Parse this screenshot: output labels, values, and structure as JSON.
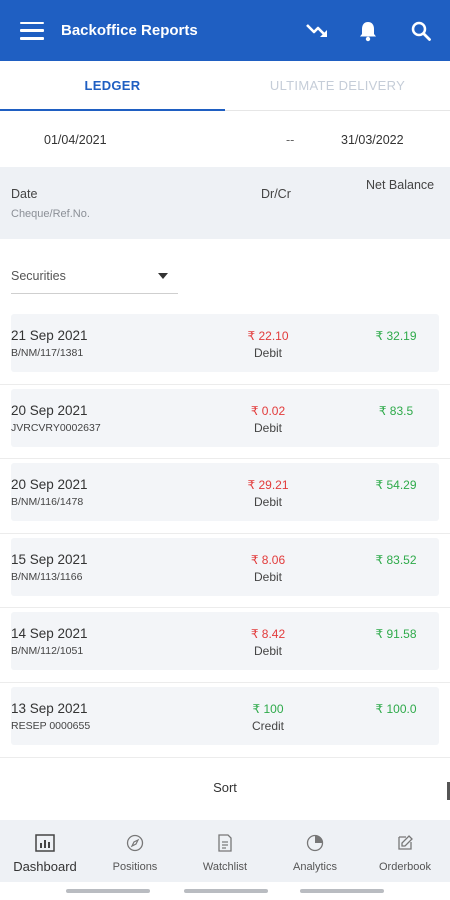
{
  "appbar": {
    "title": "Backoffice Reports",
    "icons": [
      "menu-icon",
      "trending-down-icon",
      "bell-icon",
      "search-icon"
    ],
    "color": "#1f5fc2"
  },
  "tabs": [
    {
      "label": "LEDGER",
      "active": true
    },
    {
      "label": "ULTIMATE DELIVERY",
      "active": false
    }
  ],
  "date_range": {
    "from": "01/04/2021",
    "separator": "--",
    "to": "31/03/2022"
  },
  "table_header": {
    "date": "Date",
    "cheque": "Cheque/Ref.No.",
    "drcr": "Dr/Cr",
    "net_balance": "Net Balance"
  },
  "filter": {
    "selected": "Securities"
  },
  "entries": [
    {
      "date": "21 Sep 2021",
      "ref": "B/NM/117/1381",
      "amount": "₹ 22.10",
      "type": "Debit",
      "balance": "₹ 32.19"
    },
    {
      "date": "20 Sep 2021",
      "ref": "JVRCVRY0002637",
      "amount": "₹ 0.02",
      "type": "Debit",
      "balance": "₹ 83.5"
    },
    {
      "date": "20 Sep 2021",
      "ref": "B/NM/116/1478",
      "amount": "₹ 29.21",
      "type": "Debit",
      "balance": "₹ 54.29"
    },
    {
      "date": "15 Sep 2021",
      "ref": "B/NM/113/1166",
      "amount": "₹ 8.06",
      "type": "Debit",
      "balance": "₹ 83.52"
    },
    {
      "date": "14 Sep 2021",
      "ref": "B/NM/112/1051",
      "amount": "₹ 8.42",
      "type": "Debit",
      "balance": "₹ 91.58"
    },
    {
      "date": "13 Sep 2021",
      "ref": "RESEP 0000655",
      "amount": "₹ 100",
      "type": "Credit",
      "balance": "₹ 100.0"
    }
  ],
  "colors": {
    "debit": "#e23b3b",
    "credit": "#2eaa4a"
  },
  "sort": {
    "label": "Sort"
  },
  "bottom_nav": [
    {
      "label": "Dashboard",
      "icon": "dashboard-icon",
      "active": true
    },
    {
      "label": "Positions",
      "icon": "compass-icon",
      "active": false
    },
    {
      "label": "Watchlist",
      "icon": "document-icon",
      "active": false
    },
    {
      "label": "Analytics",
      "icon": "pie-chart-icon",
      "active": false
    },
    {
      "label": "Orderbook",
      "icon": "edit-icon",
      "active": false
    }
  ]
}
